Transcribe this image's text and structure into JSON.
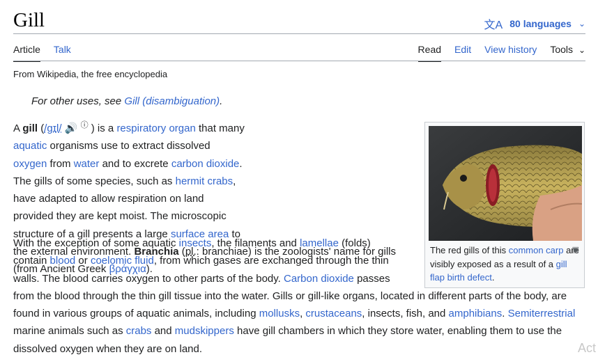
{
  "header": {
    "title": "Gill",
    "languages_label": "80 languages",
    "tabs_left": [
      "Article",
      "Talk"
    ],
    "tabs_right": [
      "Read",
      "Edit",
      "View history",
      "Tools"
    ]
  },
  "tagline": "From Wikipedia, the free encyclopedia",
  "hatnote": {
    "prefix": "For other uses, see ",
    "link": "Gill (disambiguation)",
    "suffix": "."
  },
  "p1": {
    "t1": "A ",
    "bold1": "gill",
    "t2": " (",
    "ipa": "/ɡɪl/",
    "t3": " ) is a ",
    "l1": "respiratory organ",
    "t4": " that many ",
    "l2": "aquatic",
    "t5": " organisms use to extract dissolved ",
    "l3": "oxygen",
    "t6": " from ",
    "l4": "water",
    "t7": " and to excrete ",
    "l5": "carbon dioxide",
    "t8": ". The gills of some species, such as ",
    "l6": "hermit crabs",
    "t9": ", have adapted to allow respiration on land provided they are kept moist. The microscopic structure of a gill presents a large ",
    "l7": "surface area",
    "t10": " to the external environment. ",
    "bold2": "Branchia",
    "t11": " (",
    "pl": "pl.",
    "t12": ": branchiae) is the zoologists' name for gills (from Ancient Greek ",
    "l8": "βράγχια",
    "t13": ")."
  },
  "p2": {
    "t1": "With the exception of some aquatic ",
    "l1": "insects",
    "t2": ", the filaments and ",
    "l2": "lamellae",
    "t3": " (folds) contain ",
    "l3": "blood",
    "t4": " or ",
    "l4": "coelomic fluid",
    "t5": ", from which gases are exchanged through the thin walls. The blood carries oxygen to other parts of the body. ",
    "l5": "Carbon dioxide",
    "t6": " passes from the blood through the thin gill tissue into the water. Gills or gill-like organs, located in different parts of the body, are found in various groups of aquatic animals, including ",
    "l6": "mollusks",
    "t7": ", ",
    "l7": "crustaceans",
    "t8": ", insects, fish, and ",
    "l8": "amphibians",
    "t9": ". ",
    "l9": "Semiterrestrial",
    "t10": " marine animals such as ",
    "l10": "crabs",
    "t11": " and ",
    "l11": "mudskippers",
    "t12": " have gill chambers in which they store water, enabling them to use the dissolved oxygen when they are on land."
  },
  "figure": {
    "c1": "The red gills of this ",
    "l1": "common carp",
    "c2": " are visibly exposed as a result of a ",
    "l2": "gill flap birth defect",
    "c3": "."
  },
  "watermark": "Act",
  "icons": [
    "translate-icon",
    "chevron-down-icon",
    "speaker-icon",
    "info-icon",
    "enlarge-icon"
  ]
}
